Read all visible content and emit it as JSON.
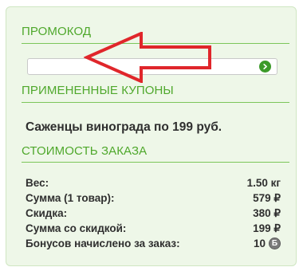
{
  "promo": {
    "title": "ПРОМОКОД",
    "input_value": "",
    "input_placeholder": "",
    "submit_icon": "chevron-right-circle-icon"
  },
  "annotation": {
    "arrow_color": "#e0262b",
    "arrow_icon": "left-arrow-icon"
  },
  "coupons": {
    "title": "ПРИМЕНЕННЫЕ КУПОНЫ",
    "items": [
      "Саженцы винограда по 199 руб."
    ]
  },
  "order": {
    "title": "СТОИМОСТЬ ЗАКАЗА",
    "rows": [
      {
        "label": "Вес:",
        "value": "1.50 кг"
      },
      {
        "label": "Сумма (1 товар):",
        "value": "579 ₽"
      },
      {
        "label": "Скидка:",
        "value": "380 ₽"
      },
      {
        "label": "Сумма со скидкой:",
        "value": "199 ₽"
      },
      {
        "label": "Бонусов начислено за заказ:",
        "value": "10",
        "icon": "bonus-coin-icon",
        "icon_glyph": "Б"
      }
    ]
  },
  "colors": {
    "accent": "#4fa82c",
    "panel_bg": "#eef7e8",
    "text": "#2f2f2f"
  }
}
